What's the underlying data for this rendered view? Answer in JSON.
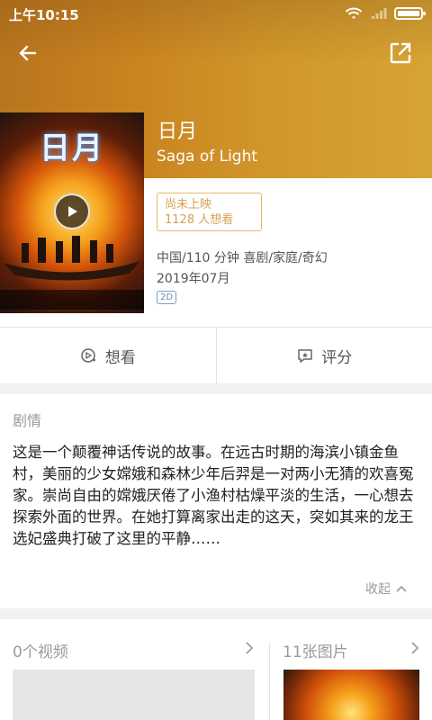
{
  "status_bar": {
    "time": "上午10:15"
  },
  "toolbar": {
    "back_icon": "arrow-left-icon",
    "share_icon": "share-external-icon"
  },
  "movie": {
    "title_cn": "日月",
    "title_en": "Saga of Light",
    "status": "尚未上映",
    "want_count": "1128 人想看",
    "meta": "中国/110 分钟  喜剧/家庭/奇幻",
    "release": "2019年07月",
    "format_tag": "2D"
  },
  "poster": {
    "title": "日月"
  },
  "actions": [
    {
      "label": "想看",
      "icon": "want-icon"
    },
    {
      "label": "评分",
      "icon": "rate-icon"
    }
  ],
  "synopsis": {
    "heading": "剧情",
    "text": "这是一个颠覆神话传说的故事。在远古时期的海滨小镇金鱼村，美丽的少女嫦娥和森林少年后羿是一对两小无猜的欢喜冤家。崇尚自由的嫦娥厌倦了小渔村枯燥平淡的生活，一心想去探索外面的世界。在她打算离家出走的这天，突如其来的龙王选妃盛典打破了这里的平静……",
    "collapse_label": "收起"
  },
  "media": {
    "videos_label": "0个视频",
    "photos_label": "11张图片"
  },
  "colors": {
    "hero_start": "#b9751e",
    "hero_end": "#d7a434",
    "status_tag": "#d7a155"
  }
}
